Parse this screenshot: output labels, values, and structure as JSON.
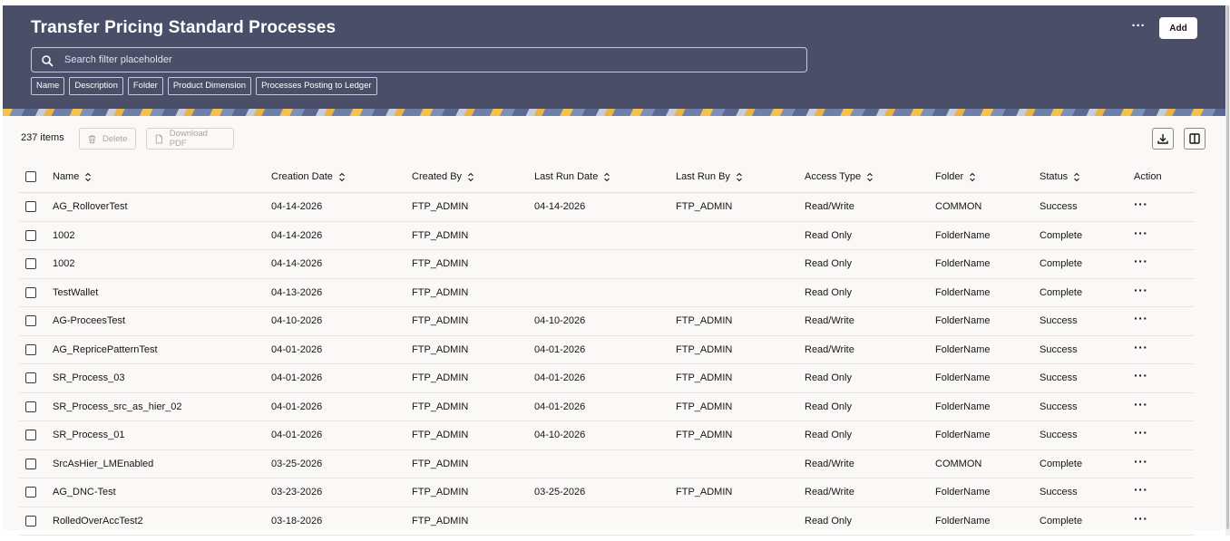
{
  "header": {
    "title": "Transfer Pricing Standard Processes",
    "more_label": "···",
    "add_label": "Add",
    "search_placeholder": "Search filter placeholder",
    "filter_chips": [
      "Name",
      "Description",
      "Folder",
      "Product Dimension",
      "Processes Posting to Ledger"
    ]
  },
  "toolbar": {
    "items_count": "237 items",
    "delete_label": "Delete",
    "download_pdf_label": "Download PDF"
  },
  "table": {
    "columns": [
      "Name",
      "Creation Date",
      "Created By",
      "Last Run Date",
      "Last Run By",
      "Access Type",
      "Folder",
      "Status",
      "Action"
    ],
    "action_glyph": "···",
    "rows": [
      {
        "name": "AG_RolloverTest",
        "created": "04-14-2026",
        "created_by": "FTP_ADMIN",
        "last_run": "04-14-2026",
        "last_run_by": "FTP_ADMIN",
        "access": "Read/Write",
        "folder": "COMMON",
        "status": "Success"
      },
      {
        "name": "1002",
        "created": "04-14-2026",
        "created_by": "FTP_ADMIN",
        "last_run": "",
        "last_run_by": "",
        "access": "Read Only",
        "folder": "FolderName",
        "status": "Complete"
      },
      {
        "name": "1002",
        "created": "04-14-2026",
        "created_by": "FTP_ADMIN",
        "last_run": "",
        "last_run_by": "",
        "access": "Read Only",
        "folder": "FolderName",
        "status": "Complete"
      },
      {
        "name": "TestWallet",
        "created": "04-13-2026",
        "created_by": "FTP_ADMIN",
        "last_run": "",
        "last_run_by": "",
        "access": "Read Only",
        "folder": "FolderName",
        "status": "Complete"
      },
      {
        "name": "AG-ProceesTest",
        "created": "04-10-2026",
        "created_by": "FTP_ADMIN",
        "last_run": "04-10-2026",
        "last_run_by": "FTP_ADMIN",
        "access": "Read/Write",
        "folder": "FolderName",
        "status": "Success"
      },
      {
        "name": "AG_RepricePatternTest",
        "created": "04-01-2026",
        "created_by": "FTP_ADMIN",
        "last_run": "04-01-2026",
        "last_run_by": "FTP_ADMIN",
        "access": "Read/Write",
        "folder": "FolderName",
        "status": "Success"
      },
      {
        "name": "SR_Process_03",
        "created": "04-01-2026",
        "created_by": "FTP_ADMIN",
        "last_run": "04-01-2026",
        "last_run_by": "FTP_ADMIN",
        "access": "Read Only",
        "folder": "FolderName",
        "status": "Success"
      },
      {
        "name": "SR_Process_src_as_hier_02",
        "created": "04-01-2026",
        "created_by": "FTP_ADMIN",
        "last_run": "04-01-2026",
        "last_run_by": "FTP_ADMIN",
        "access": "Read Only",
        "folder": "FolderName",
        "status": "Success"
      },
      {
        "name": "SR_Process_01",
        "created": "04-01-2026",
        "created_by": "FTP_ADMIN",
        "last_run": "04-10-2026",
        "last_run_by": "FTP_ADMIN",
        "access": "Read Only",
        "folder": "FolderName",
        "status": "Success"
      },
      {
        "name": "SrcAsHier_LMEnabled",
        "created": "03-25-2026",
        "created_by": "FTP_ADMIN",
        "last_run": "",
        "last_run_by": "",
        "access": "Read/Write",
        "folder": "COMMON",
        "status": "Complete"
      },
      {
        "name": "AG_DNC-Test",
        "created": "03-23-2026",
        "created_by": "FTP_ADMIN",
        "last_run": "03-25-2026",
        "last_run_by": "FTP_ADMIN",
        "access": "Read/Write",
        "folder": "FolderName",
        "status": "Success"
      },
      {
        "name": "RolledOverAccTest2",
        "created": "03-18-2026",
        "created_by": "FTP_ADMIN",
        "last_run": "",
        "last_run_by": "",
        "access": "Read Only",
        "folder": "FolderName",
        "status": "Complete"
      }
    ]
  }
}
